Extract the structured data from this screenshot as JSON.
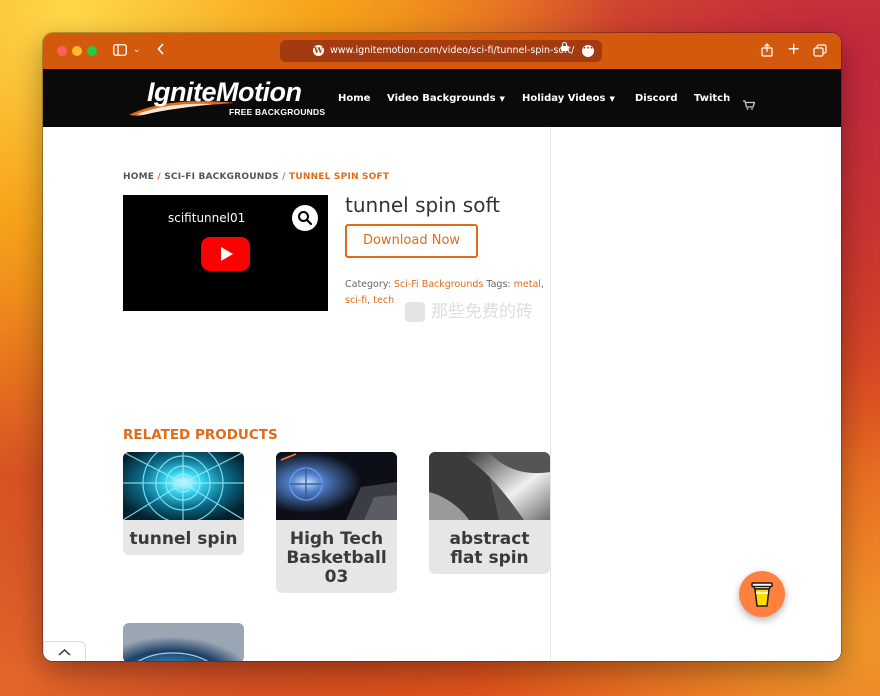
{
  "browser": {
    "url": "www.ignitemotion.com/video/sci-fi/tunnel-spin-soft/"
  },
  "site": {
    "logo_main": "IgniteMotion",
    "logo_sub": "FREE BACKGROUNDS",
    "nav": [
      {
        "label": "Home"
      },
      {
        "label": "Video Backgrounds",
        "dropdown": true
      },
      {
        "label": "Holiday Videos",
        "dropdown": true
      },
      {
        "label": "Discord"
      },
      {
        "label": "Twitch"
      }
    ]
  },
  "breadcrumb": {
    "home": "HOME",
    "sep": " / ",
    "category": "SCI-FI BACKGROUNDS",
    "current": "TUNNEL SPIN SOFT"
  },
  "product": {
    "video_title": "scifitunnel01",
    "title": "tunnel spin soft",
    "download_label": "Download Now",
    "category_label": "Category:",
    "category": "Sci-Fi Backgrounds",
    "tags_label": "Tags:",
    "tags": [
      "metal",
      "sci-fi",
      "tech"
    ],
    "tag_sep": ", "
  },
  "watermark": "那些免费的砖",
  "related": {
    "heading": "RELATED PRODUCTS",
    "items": [
      {
        "title": "tunnel spin"
      },
      {
        "title": "High Tech Basketball 03"
      },
      {
        "title": "abstract flat spin"
      },
      {
        "title": ""
      }
    ]
  },
  "colors": {
    "accent": "#e06b1a",
    "titlebar": "#d35a0c",
    "nav_bg": "#0a0a0a"
  },
  "icons": {
    "sidebar_toggle": "sidebar-icon",
    "back": "chevron-left-icon",
    "share": "share-icon",
    "new_tab": "plus-icon",
    "tabs": "tabs-icon",
    "cart": "cart-icon",
    "zoom": "magnifier-icon",
    "play": "youtube-play-icon",
    "scroll_top": "chevron-up-icon",
    "coffee": "coffee-cup-icon"
  }
}
